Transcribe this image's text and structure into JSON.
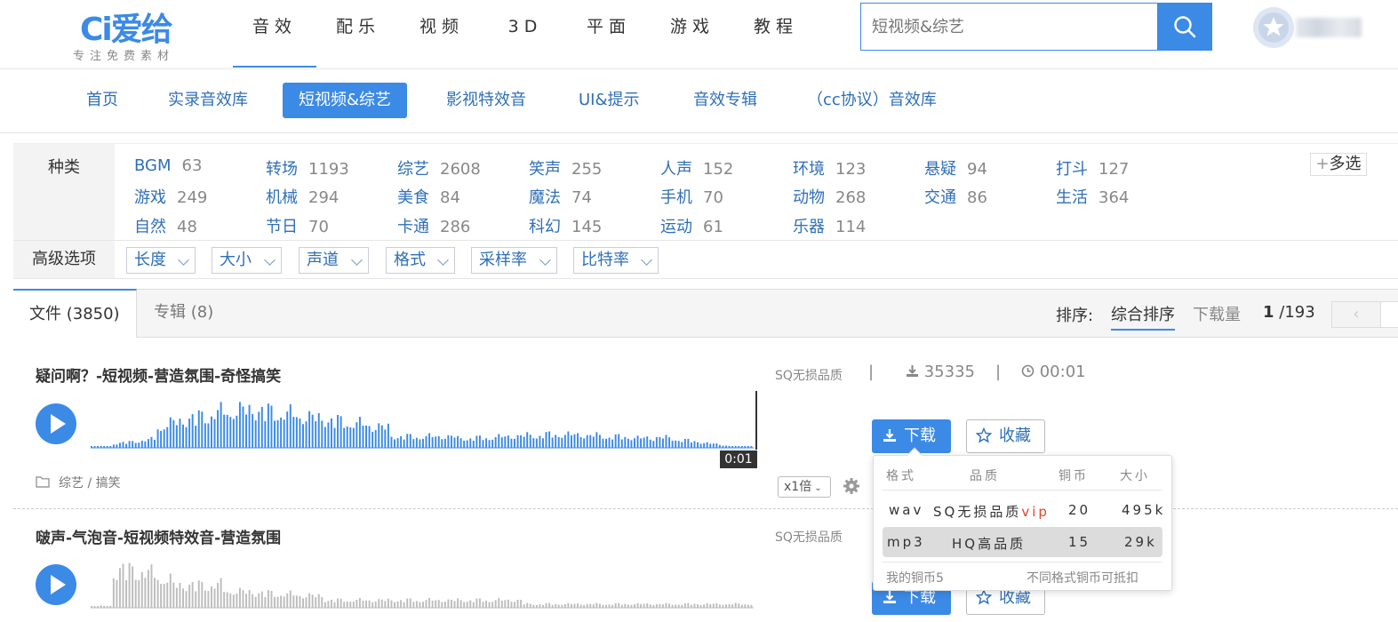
{
  "brand": {
    "name": "爱给",
    "mark": "Ci",
    "tagline": "专注免费素材"
  },
  "main_nav": [
    "音效",
    "配乐",
    "视频",
    "3D",
    "平面",
    "游戏",
    "教程"
  ],
  "search": {
    "placeholder": "短视频&综艺"
  },
  "sub_nav": [
    "首页",
    "实录音效库",
    "短视频&综艺",
    "影视特效音",
    "UI&提示",
    "音效专辑",
    "（cc协议）音效库"
  ],
  "filter": {
    "label": "种类",
    "multi_select": "多选",
    "categories": [
      {
        "name": "BGM",
        "count": "63"
      },
      {
        "name": "转场",
        "count": "1193"
      },
      {
        "name": "综艺",
        "count": "2608"
      },
      {
        "name": "笑声",
        "count": "255"
      },
      {
        "name": "人声",
        "count": "152"
      },
      {
        "name": "环境",
        "count": "123"
      },
      {
        "name": "悬疑",
        "count": "94"
      },
      {
        "name": "打斗",
        "count": "127"
      },
      {
        "name": "游戏",
        "count": "249"
      },
      {
        "name": "机械",
        "count": "294"
      },
      {
        "name": "美食",
        "count": "84"
      },
      {
        "name": "魔法",
        "count": "74"
      },
      {
        "name": "手机",
        "count": "70"
      },
      {
        "name": "动物",
        "count": "268"
      },
      {
        "name": "交通",
        "count": "86"
      },
      {
        "name": "生活",
        "count": "364"
      },
      {
        "name": "自然",
        "count": "48"
      },
      {
        "name": "节日",
        "count": "70"
      },
      {
        "name": "卡通",
        "count": "286"
      },
      {
        "name": "科幻",
        "count": "145"
      },
      {
        "name": "运动",
        "count": "61"
      },
      {
        "name": "乐器",
        "count": "114"
      }
    ],
    "advanced_label": "高级选项",
    "advanced": [
      "长度",
      "大小",
      "声道",
      "格式",
      "采样率",
      "比特率"
    ]
  },
  "tabs": {
    "files": "文件 (3850)",
    "albums": "专辑 (8)"
  },
  "sort": {
    "label": "排序:",
    "options": [
      "综合排序",
      "下载量"
    ]
  },
  "pager": {
    "current": "1",
    "total": "/193",
    "prev": "‹"
  },
  "items": [
    {
      "title": "疑问啊？-短视频-营造氛围-奇怪搞笑",
      "tags": "综艺 / 搞笑",
      "quality": "SQ无损品质",
      "downloads": "35335",
      "duration": "00:01",
      "time_badge": "0:01",
      "speed": "x1倍",
      "download_label": "下载",
      "favorite_label": "收藏"
    },
    {
      "title": "啵声-气泡音-短视频特效音-营造氛围",
      "quality": "SQ无损品质",
      "download_label": "下载",
      "favorite_label": "收藏"
    }
  ],
  "popup": {
    "headers": [
      "格式",
      "品质",
      "铜币",
      "大小"
    ],
    "rows": [
      {
        "format": "wav",
        "quality": "SQ无损品质",
        "vip": "vip",
        "coins": "20",
        "size": "495k"
      },
      {
        "format": "mp3",
        "quality": "HQ高品质",
        "vip": "",
        "coins": "15",
        "size": "29k"
      }
    ],
    "footer_left": "我的铜币5",
    "footer_right": "不同格式铜币可抵扣"
  },
  "colors": {
    "accent": "#3b8ae6",
    "link": "#2f6fb8",
    "vip": "#e0442a",
    "wave_active": "#3b8ae6",
    "wave_idle": "#bdbdbd"
  }
}
